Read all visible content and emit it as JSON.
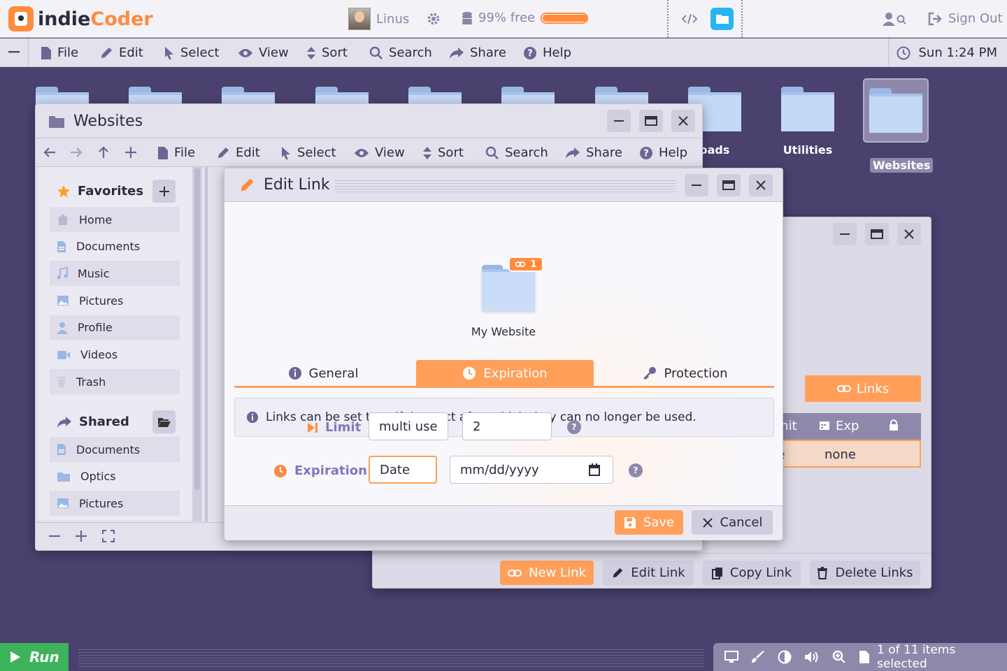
{
  "app": {
    "logo_part1": "indie",
    "logo_part2": "Coder"
  },
  "topbar": {
    "user_name": "Linus",
    "storage_text": "99% free",
    "storage_used_fraction": 0.99,
    "signout_label": "Sign Out"
  },
  "menubar": {
    "items": [
      "File",
      "Edit",
      "Select",
      "View",
      "Sort",
      "Search",
      "Share",
      "Help"
    ],
    "clock": "Sun 1:24 PM"
  },
  "desktop_icons": [
    "",
    "",
    "",
    "",
    "",
    "",
    "",
    "oads",
    "Utilities",
    "Websites"
  ],
  "websites_window": {
    "title": "Websites",
    "toolbar": [
      "File",
      "Edit",
      "Select",
      "View",
      "Sort",
      "Search",
      "Share",
      "Help"
    ],
    "favorites_label": "Favorites",
    "favorites": [
      "Home",
      "Documents",
      "Music",
      "Pictures",
      "Profile",
      "Videos",
      "Trash"
    ],
    "shared_label": "Shared",
    "shared": [
      "Documents",
      "Optics",
      "Pictures"
    ]
  },
  "links_window": {
    "tab_label": "Links",
    "col_limit": "Limit",
    "col_exp": "Exp",
    "row_limit": "one",
    "row_exp": "none",
    "buttons": {
      "new": "New Link",
      "edit": "Edit Link",
      "copy": "Copy Link",
      "delete": "Delete Links"
    }
  },
  "dialog": {
    "title": "Edit Link",
    "file_name": "My Website",
    "badge_count": "1",
    "tabs": [
      "General",
      "Expiration",
      "Protection"
    ],
    "active_tab": "Expiration",
    "info_text": "Links can be set to self destruct after which they can no longer be used.",
    "limit_label": "Limit",
    "limit_mode": "multi use",
    "limit_value": "2",
    "expiration_label": "Expiration",
    "expiration_mode": "Date",
    "date_placeholder": "mm/dd/yyyy",
    "save_label": "Save",
    "cancel_label": "Cancel"
  },
  "taskbar": {
    "run_label": "Run",
    "status": "1 of 11 items selected"
  },
  "colors": {
    "accent": "#ff9f5a",
    "desktop": "#4a416e",
    "run": "#3db35b"
  }
}
